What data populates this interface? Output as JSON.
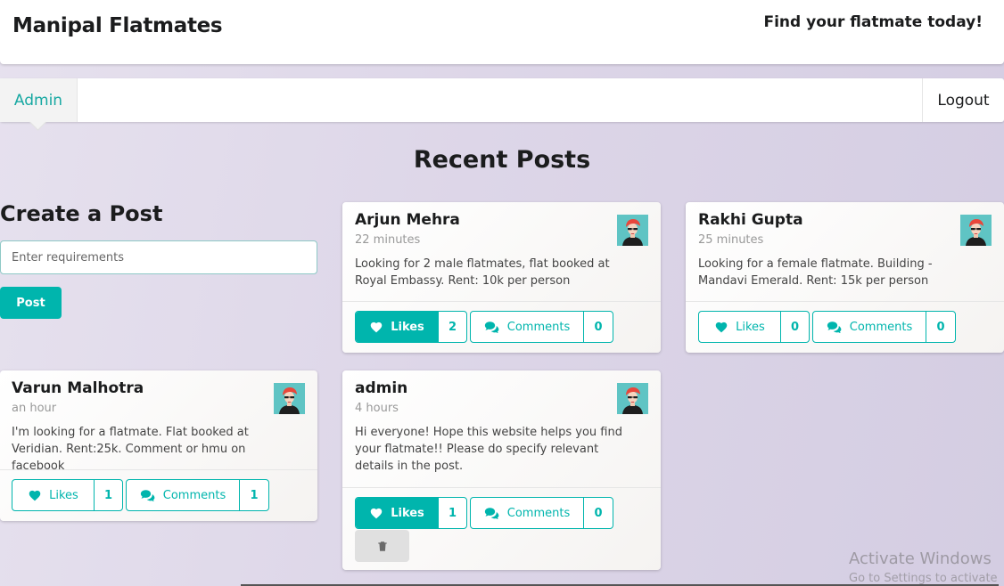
{
  "header": {
    "brand": "Manipal Flatmates",
    "tagline": "Find your flatmate today!"
  },
  "menu": {
    "user": "Admin",
    "logout": "Logout"
  },
  "main": {
    "title": "Recent Posts"
  },
  "create": {
    "title": "Create a Post",
    "placeholder": "Enter requirements",
    "button": "Post"
  },
  "posts": [
    {
      "name": "Arjun Mehra",
      "time": "22 minutes",
      "text": "Looking for 2 male flatmates, flat booked at Royal Embassy. Rent: 10k per person",
      "likes_label": "Likes",
      "likes": "2",
      "comments_label": "Comments",
      "comments": "0",
      "liked": true
    },
    {
      "name": "Rakhi Gupta",
      "time": "25 minutes",
      "text": "Looking for a female flatmate. Building - Mandavi Emerald. Rent: 15k per person",
      "likes_label": "Likes",
      "likes": "0",
      "comments_label": "Comments",
      "comments": "0",
      "liked": false
    },
    {
      "name": "Varun Malhotra",
      "time": "an hour",
      "text": "I'm looking for a flatmate. Flat booked at Veridian. Rent:25k. Comment or hmu on facebook",
      "likes_label": "Likes",
      "likes": "1",
      "comments_label": "Comments",
      "comments": "1",
      "liked": false
    },
    {
      "name": "admin",
      "time": "4 hours",
      "text": "Hi everyone! Hope this website helps you find your flatmate!! Please do specify relevant details in the post.",
      "likes_label": "Likes",
      "likes": "1",
      "comments_label": "Comments",
      "comments": "0",
      "liked": true
    }
  ],
  "watermark": {
    "title": "Activate Windows",
    "subtitle": "Go to Settings to activate"
  },
  "colors": {
    "accent": "#00b5ad",
    "accent_text": "#17a8a2"
  },
  "icons": [
    "heart-icon",
    "comments-icon",
    "trash-icon",
    "avatar"
  ]
}
